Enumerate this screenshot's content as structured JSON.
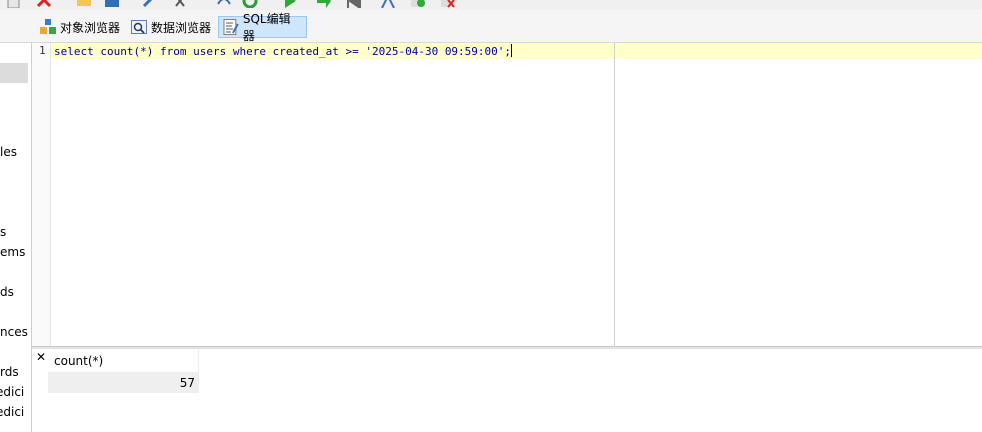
{
  "toolbar_tabs": [
    {
      "label": "对象浏览器",
      "icon": "object-browser-icon"
    },
    {
      "label": "数据浏览器",
      "icon": "data-browser-icon"
    },
    {
      "label": "SQL编辑器",
      "icon": "sql-editor-icon",
      "active": true
    }
  ],
  "left_panel": {
    "items": [
      "les",
      "s",
      "ems",
      "ds",
      "nces",
      "rds",
      "edici",
      "edici"
    ]
  },
  "editor": {
    "line_number": "1",
    "sql": {
      "kw_select": "select",
      "fn_count": "count(*)",
      "kw_from": "from",
      "table": "users",
      "kw_where": "where",
      "column": "created_at",
      "operator": ">=",
      "literal": "'2025-04-30 09:59:00'",
      "terminator": ";"
    }
  },
  "results": {
    "close_symbol": "✕",
    "column_header": "count(*)",
    "rows": [
      "57"
    ]
  },
  "colors": {
    "keyword": "#0000aa",
    "current_line": "#ffffc8",
    "active_tab": "#cfe5fa"
  }
}
